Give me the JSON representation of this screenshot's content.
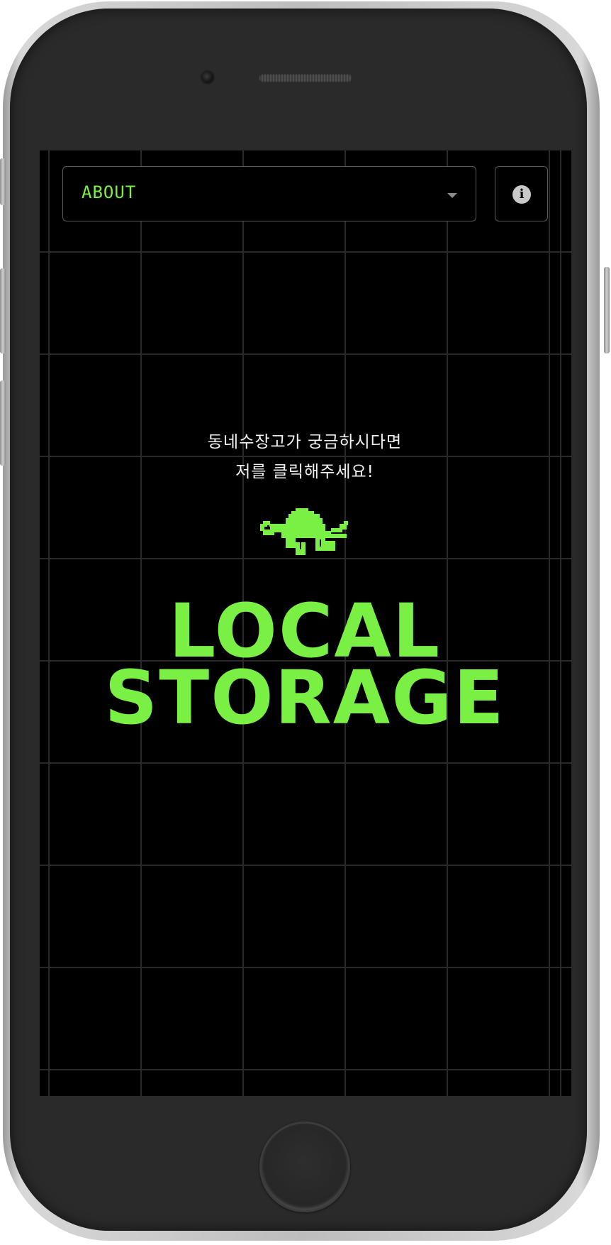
{
  "header": {
    "menu_select": {
      "value": "ABOUT"
    },
    "info_icon": "info-icon"
  },
  "main": {
    "hint_line_1": "동네수장고가 궁금하시다면",
    "hint_line_2": "저를 클릭해주세요!",
    "turtle_icon": "turtle-pixel-icon",
    "title_line_1": "LOCAL",
    "title_line_2": "STORAGE"
  },
  "colors": {
    "accent": "#7bf044",
    "background": "#000000",
    "grid": "#2a2a2a",
    "text": "#f2f2f2"
  }
}
